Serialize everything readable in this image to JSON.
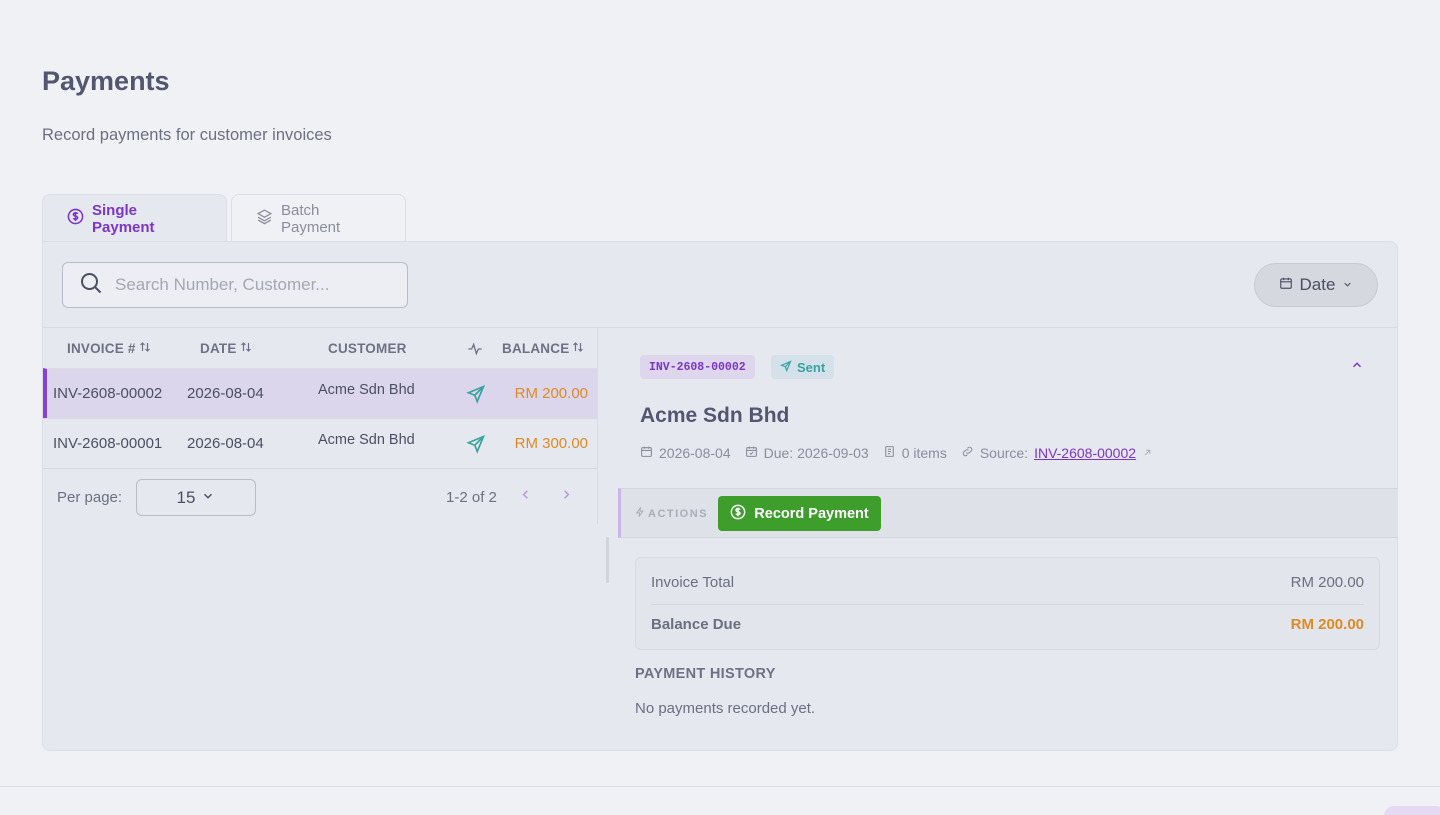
{
  "page": {
    "title": "Payments",
    "subtitle": "Record payments for customer invoices"
  },
  "tabs": [
    {
      "label": "Single Payment",
      "active": true
    },
    {
      "label": "Batch Payment",
      "active": false
    }
  ],
  "search": {
    "placeholder": "Search Number, Customer...",
    "value": ""
  },
  "date_filter": {
    "label": "Date"
  },
  "table": {
    "columns": [
      "INVOICE #",
      "DATE",
      "CUSTOMER",
      "BALANCE"
    ],
    "rows": [
      {
        "invoice": "INV-2608-00002",
        "date": "2026-08-04",
        "customer": "Acme Sdn Bhd",
        "status_icon": "send-icon",
        "balance": "RM 200.00",
        "selected": true
      },
      {
        "invoice": "INV-2608-00001",
        "date": "2026-08-04",
        "customer": "Acme Sdn Bhd",
        "status_icon": "send-icon",
        "balance": "RM 300.00",
        "selected": false
      }
    ]
  },
  "pagination": {
    "per_page_label": "Per page:",
    "per_page_value": "15",
    "range": "1-2 of 2"
  },
  "detail": {
    "invoice_badge": "INV-2608-00002",
    "status_badge": "Sent",
    "customer": "Acme Sdn Bhd",
    "date": "2026-08-04",
    "due": "Due: 2026-09-03",
    "items": "0 items",
    "source_label": "Source:",
    "source_link": "INV-2608-00002",
    "actions_label": "ACTIONS",
    "record_button": "Record Payment",
    "invoice_total_label": "Invoice Total",
    "invoice_total_value": "RM 200.00",
    "balance_due_label": "Balance Due",
    "balance_due_value": "RM 200.00",
    "history_title": "PAYMENT HISTORY",
    "history_empty": "No payments recorded yet."
  },
  "colors": {
    "accent": "#7b35c9",
    "balance": "#dc8a25",
    "success": "#3d9e2b",
    "status_sent": "#3aa3a0"
  }
}
